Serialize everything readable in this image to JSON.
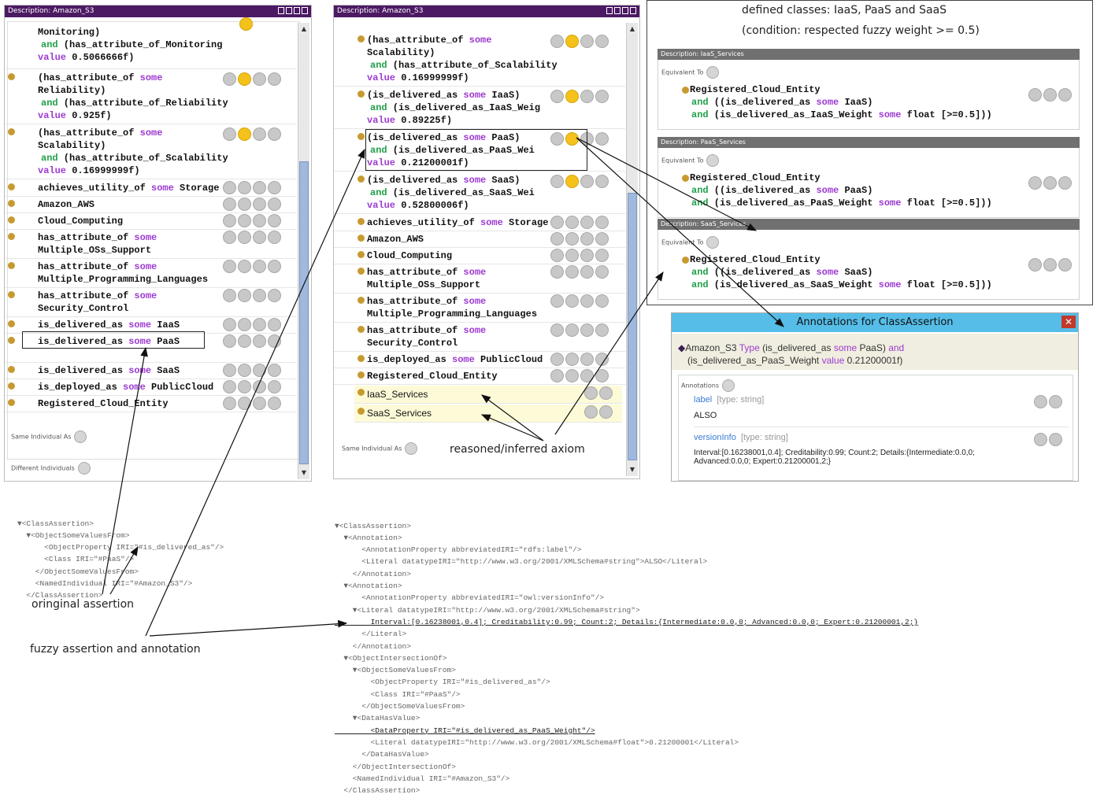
{
  "left_panel": {
    "title": "Description: Amazon_S3",
    "rows": [
      {
        "l1a": "Monitoring)",
        "l2a": "and",
        "l2b": " (has_attribute_of_Monitoring",
        "l3a": "value",
        "l3b": " 0.5066666f)"
      },
      {
        "l1a": "(has_attribute_of ",
        "l1b": "some",
        "l1c": "",
        "l1d": "Reliability)",
        "l2a": "and",
        "l2b": " (has_attribute_of_Reliability",
        "l3a": "value",
        "l3b": " 0.925f)"
      },
      {
        "l1a": "(has_attribute_of ",
        "l1b": "some",
        "l1d": "Scalability)",
        "l2a": "and",
        "l2b": " (has_attribute_of_Scalability",
        "l3a": "value",
        "l3b": " 0.16999999f)"
      },
      {
        "a": "achieves_utility_of ",
        "b": "some",
        "c": " Storage"
      },
      {
        "a": "Amazon_AWS"
      },
      {
        "a": "Cloud_Computing"
      },
      {
        "a": "has_attribute_of ",
        "b": "some",
        "d": "Multiple_OSs_Support"
      },
      {
        "a": "has_attribute_of ",
        "b": "some",
        "d": "Multiple_Programming_Languages"
      },
      {
        "a": "has_attribute_of ",
        "b": "some",
        "d": "Security_Control"
      },
      {
        "a": "is_delivered_as ",
        "b": "some",
        "c": " IaaS"
      },
      {
        "a": "is_delivered_as ",
        "b": "some",
        "c": " PaaS"
      },
      {
        "a": "is_delivered_as ",
        "b": "some",
        "c": " SaaS"
      },
      {
        "a": "is_deployed_as ",
        "b": "some",
        "c": " PublicCloud"
      },
      {
        "a": "Registered_Cloud_Entity"
      }
    ],
    "same_individual": "Same Individual As",
    "different_individuals": "Different Individuals"
  },
  "mid_panel": {
    "title": "Description: Amazon_S3",
    "rows": [
      {
        "l1a": "(has_attribute_of ",
        "l1b": "some",
        "l1d": "Scalability)",
        "l2a": "and",
        "l2b": " (has_attribute_of_Scalability",
        "l3a": "value",
        "l3b": " 0.16999999f)"
      },
      {
        "l1a": "(is_delivered_as ",
        "l1b": "some",
        "l1c": " IaaS)",
        "l2a": "and",
        "l2b": " (is_delivered_as_IaaS_Weig",
        "l3a": "value",
        "l3b": " 0.89225f)"
      },
      {
        "l1a": "(is_delivered_as ",
        "l1b": "some",
        "l1c": " PaaS)",
        "l2a": "and",
        "l2b": " (is_delivered_as_PaaS_Wei",
        "l3a": "value",
        "l3b": " 0.21200001f)"
      },
      {
        "l1a": "(is_delivered_as ",
        "l1b": "some",
        "l1c": " SaaS)",
        "l2a": "and",
        "l2b": " (is_delivered_as_SaaS_Wei",
        "l3a": "value",
        "l3b": " 0.52800006f)"
      },
      {
        "a": "achieves_utility_of ",
        "b": "some",
        "c": " Storage"
      },
      {
        "a": "Amazon_AWS"
      },
      {
        "a": "Cloud_Computing"
      },
      {
        "a": "has_attribute_of ",
        "b": "some",
        "d": "Multiple_OSs_Support"
      },
      {
        "a": "has_attribute_of ",
        "b": "some",
        "d": "Multiple_Programming_Languages"
      },
      {
        "a": "has_attribute_of ",
        "b": "some",
        "d": "Security_Control"
      },
      {
        "a": "is_deployed_as ",
        "b": "some",
        "c": " PublicCloud"
      },
      {
        "a": "Registered_Cloud_Entity"
      },
      {
        "a": "IaaS_Services"
      },
      {
        "a": "SaaS_Services"
      }
    ],
    "same_individual": "Same Individual As"
  },
  "defined_classes": {
    "heading1": "defined classes: IaaS, PaaS and SaaS",
    "heading2": "(condition: respected fuzzy weight >= 0.5)",
    "panels": [
      {
        "title": "Description: IaaS_Services",
        "equiv": "Equivalent To",
        "l1": "Registered_Cloud_Entity",
        "l2a": "and",
        "l2b": " ((is_delivered_as ",
        "l2c": "some",
        "l2d": " IaaS)",
        "l3a": "and",
        "l3b": " (is_delivered_as_IaaS_Weight ",
        "l3c": "some",
        "l3d": " float [>=0.5]))"
      },
      {
        "title": "Description: PaaS_Services",
        "equiv": "Equivalent To",
        "l1": "Registered_Cloud_Entity",
        "l2a": "and",
        "l2b": " ((is_delivered_as ",
        "l2c": "some",
        "l2d": " PaaS)",
        "l3a": "and",
        "l3b": " (is_delivered_as_PaaS_Weight ",
        "l3c": "some",
        "l3d": " float [>=0.5]))"
      },
      {
        "title": "Description: SaaS_Services",
        "equiv": "Equivalent To",
        "l1": "Registered_Cloud_Entity",
        "l2a": "and",
        "l2b": " ((is_delivered_as ",
        "l2c": "some",
        "l2d": " SaaS)",
        "l3a": "and",
        "l3b": " (is_delivered_as_SaaS_Weight ",
        "l3c": "some",
        "l3d": " float [>=0.5]))"
      }
    ]
  },
  "annotations": {
    "title": "Annotations for ClassAssertion",
    "close": "✕",
    "assert_a": "Amazon_S3 ",
    "assert_b": "Type",
    "assert_c": " (is_delivered_as ",
    "assert_d": "some",
    "assert_e": " PaaS) ",
    "assert_f": "and",
    "assert_g": "(is_delivered_as_PaaS_Weight ",
    "assert_h": "value",
    "assert_i": " 0.21200001f)",
    "section": "Annotations",
    "label_name": "label",
    "label_type": "[type: string]",
    "label_value": "ALSO",
    "vi_name": "versionInfo",
    "vi_type": "[type: string]",
    "vi_value1": "Interval:[0.16238001,0.4]; Creditability:0.99; Count:2; Details:{Intermediate:0.0,0;",
    "vi_value2": "Advanced:0.0,0; Expert:0.21200001,2;}"
  },
  "captions": {
    "reasoned": "reasoned/inferred axiom",
    "original": "oringinal assertion",
    "fuzzy": "fuzzy assertion and annotation"
  },
  "xml_left": [
    "▼<ClassAssertion>",
    "  ▼<ObjectSomeValuesFrom>",
    "      <ObjectProperty IRI=\"#is_delivered_as\"/>",
    "      <Class IRI=\"#PaaS\"/>",
    "    </ObjectSomeValuesFrom>",
    "    <NamedIndividual IRI=\"#Amazon_S3\"/>",
    "  </ClassAssertion>"
  ],
  "xml_right": [
    "▼<ClassAssertion>",
    "  ▼<Annotation>",
    "      <AnnotationProperty abbreviatedIRI=\"rdfs:label\"/>",
    "      <Literal datatypeIRI=\"http://www.w3.org/2001/XMLSchema#string\">ALSO</Literal>",
    "    </Annotation>",
    "  ▼<Annotation>",
    "      <AnnotationProperty abbreviatedIRI=\"owl:versionInfo\"/>",
    "    ▼<Literal datatypeIRI=\"http://www.w3.org/2001/XMLSchema#string\">",
    "        Interval:[0.16238001,0.4]; Creditability:0.99; Count:2; Details:{Intermediate:0.0,0; Advanced:0.0,0; Expert:0.21200001,2;}",
    "      </Literal>",
    "    </Annotation>",
    "  ▼<ObjectIntersectionOf>",
    "    ▼<ObjectSomeValuesFrom>",
    "        <ObjectProperty IRI=\"#is_delivered_as\"/>",
    "        <Class IRI=\"#PaaS\"/>",
    "      </ObjectSomeValuesFrom>",
    "    ▼<DataHasValue>",
    "        <DataProperty IRI=\"#is_delivered_as_PaaS_Weight\"/>",
    "        <Literal datatypeIRI=\"http://www.w3.org/2001/XMLSchema#float\">0.21200001</Literal>",
    "      </DataHasValue>",
    "    </ObjectIntersectionOf>",
    "    <NamedIndividual IRI=\"#Amazon_S3\"/>",
    "  </ClassAssertion>"
  ]
}
